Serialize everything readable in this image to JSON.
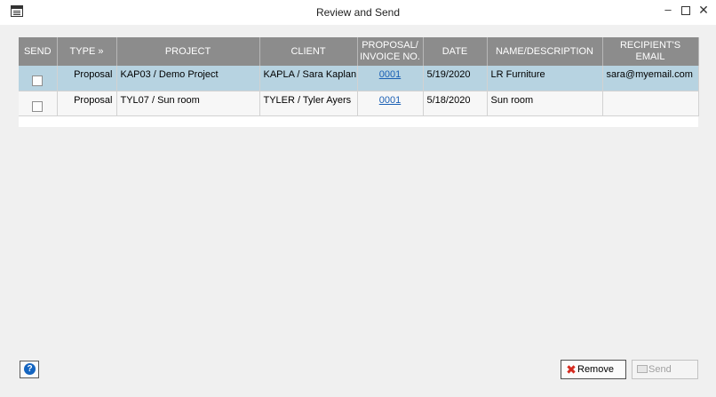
{
  "window": {
    "title": "Review and Send",
    "minimize": "–",
    "close": "✕"
  },
  "table": {
    "columns": [
      "SEND",
      "TYPE »",
      "PROJECT",
      "CLIENT",
      "PROPOSAL/\nINVOICE NO.",
      "DATE",
      "NAME/DESCRIPTION",
      "RECIPIENT'S EMAIL"
    ],
    "rows": [
      {
        "selected": true,
        "send": false,
        "type": "Proposal",
        "project": "KAP03 / Demo Project",
        "client": "KAPLA / Sara Kaplan",
        "invoice_no": "0001",
        "date": "5/19/2020",
        "name": "LR Furniture",
        "email": "sara@myemail.com"
      },
      {
        "selected": false,
        "send": false,
        "type": "Proposal",
        "project": "TYL07 / Sun room",
        "client": "TYLER / Tyler Ayers",
        "invoice_no": "0001",
        "date": "5/18/2020",
        "name": "Sun room",
        "email": ""
      }
    ]
  },
  "footer": {
    "help_glyph": "?",
    "remove_label": "Remove",
    "remove_icon": "✖",
    "send_label": "Send"
  },
  "colors": {
    "header_bg": "#8c8c8c",
    "selected_row": "#b7d3e1",
    "link": "#1a5fb4",
    "remove_icon": "#d42a1f",
    "help_icon": "#1565c0"
  }
}
